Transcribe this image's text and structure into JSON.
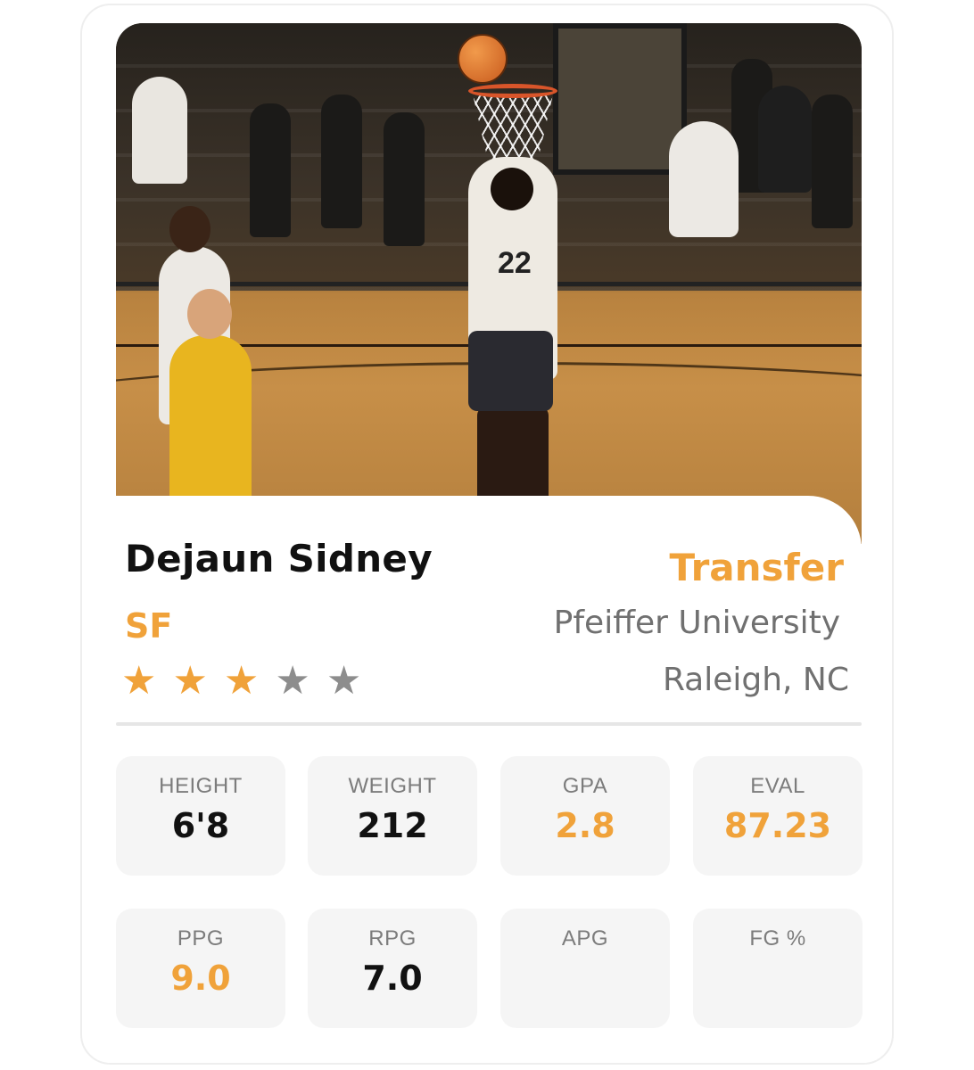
{
  "player": {
    "name": "Dejaun Sidney",
    "position": "SF",
    "status": "Transfer",
    "school": "Pfeiffer University",
    "location": "Raleigh, NC",
    "rating": {
      "stars_filled": 3,
      "stars_total": 5,
      "star_glyph": "★"
    },
    "photo": {
      "jersey_number": "22"
    }
  },
  "stats_row1": [
    {
      "label": "HEIGHT",
      "value": "6'8"
    },
    {
      "label": "WEIGHT",
      "value": "212"
    },
    {
      "label": "GPA",
      "value": "2.8"
    },
    {
      "label": "EVAL",
      "value": "87.23"
    }
  ],
  "stats_row2": [
    {
      "label": "PPG",
      "value": "9.0"
    },
    {
      "label": "RPG",
      "value": "7.0"
    },
    {
      "label": "APG",
      "value": ""
    },
    {
      "label": "FG %",
      "value": ""
    }
  ],
  "colors": {
    "accent": "#f0a23a",
    "text": "#111111",
    "muted": "#707070",
    "star_off": "#8d8d8d",
    "tile_bg": "#f5f5f5"
  }
}
